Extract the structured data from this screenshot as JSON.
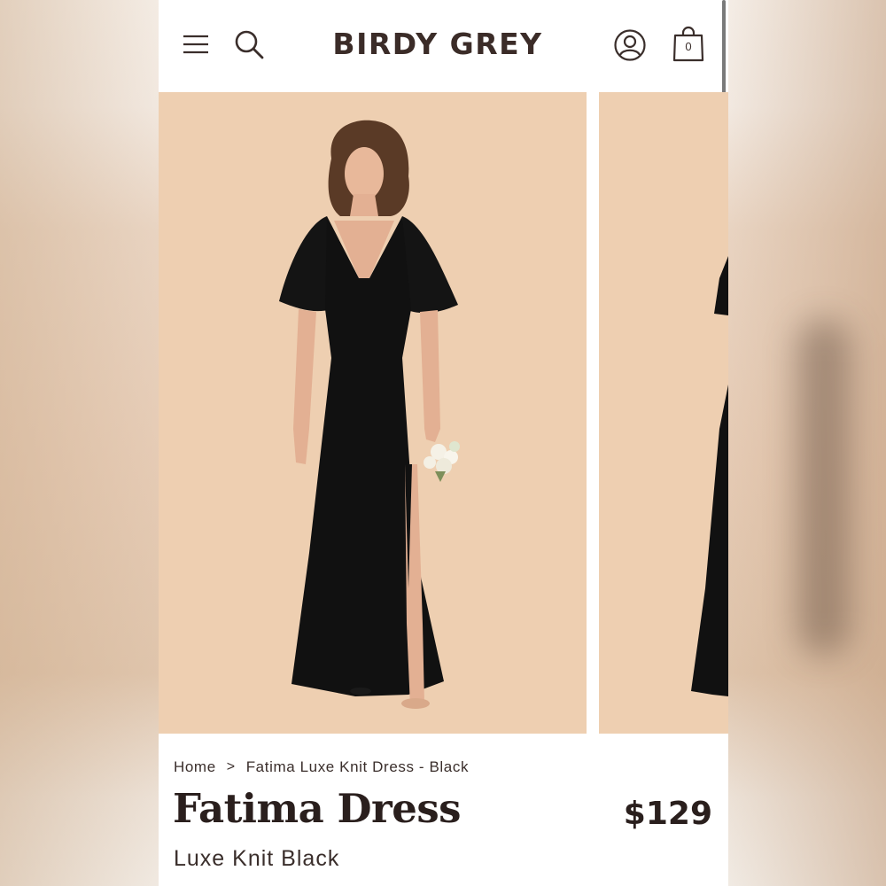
{
  "header": {
    "brand": "BIRDY GREY",
    "cart_count": "0",
    "icons": [
      "menu-icon",
      "search-icon",
      "account-icon",
      "shopping-bag-icon"
    ]
  },
  "gallery": {
    "background_color": "#eecfb1",
    "dress_color": "#111111",
    "images": [
      "model-black-dress-front",
      "model-black-dress-side"
    ]
  },
  "breadcrumb": {
    "home": "Home",
    "separator": ">",
    "current": "Fatima Luxe Knit Dress - Black"
  },
  "product": {
    "name": "Fatima Dress",
    "price": "$129",
    "variant": "Luxe Knit Black"
  }
}
